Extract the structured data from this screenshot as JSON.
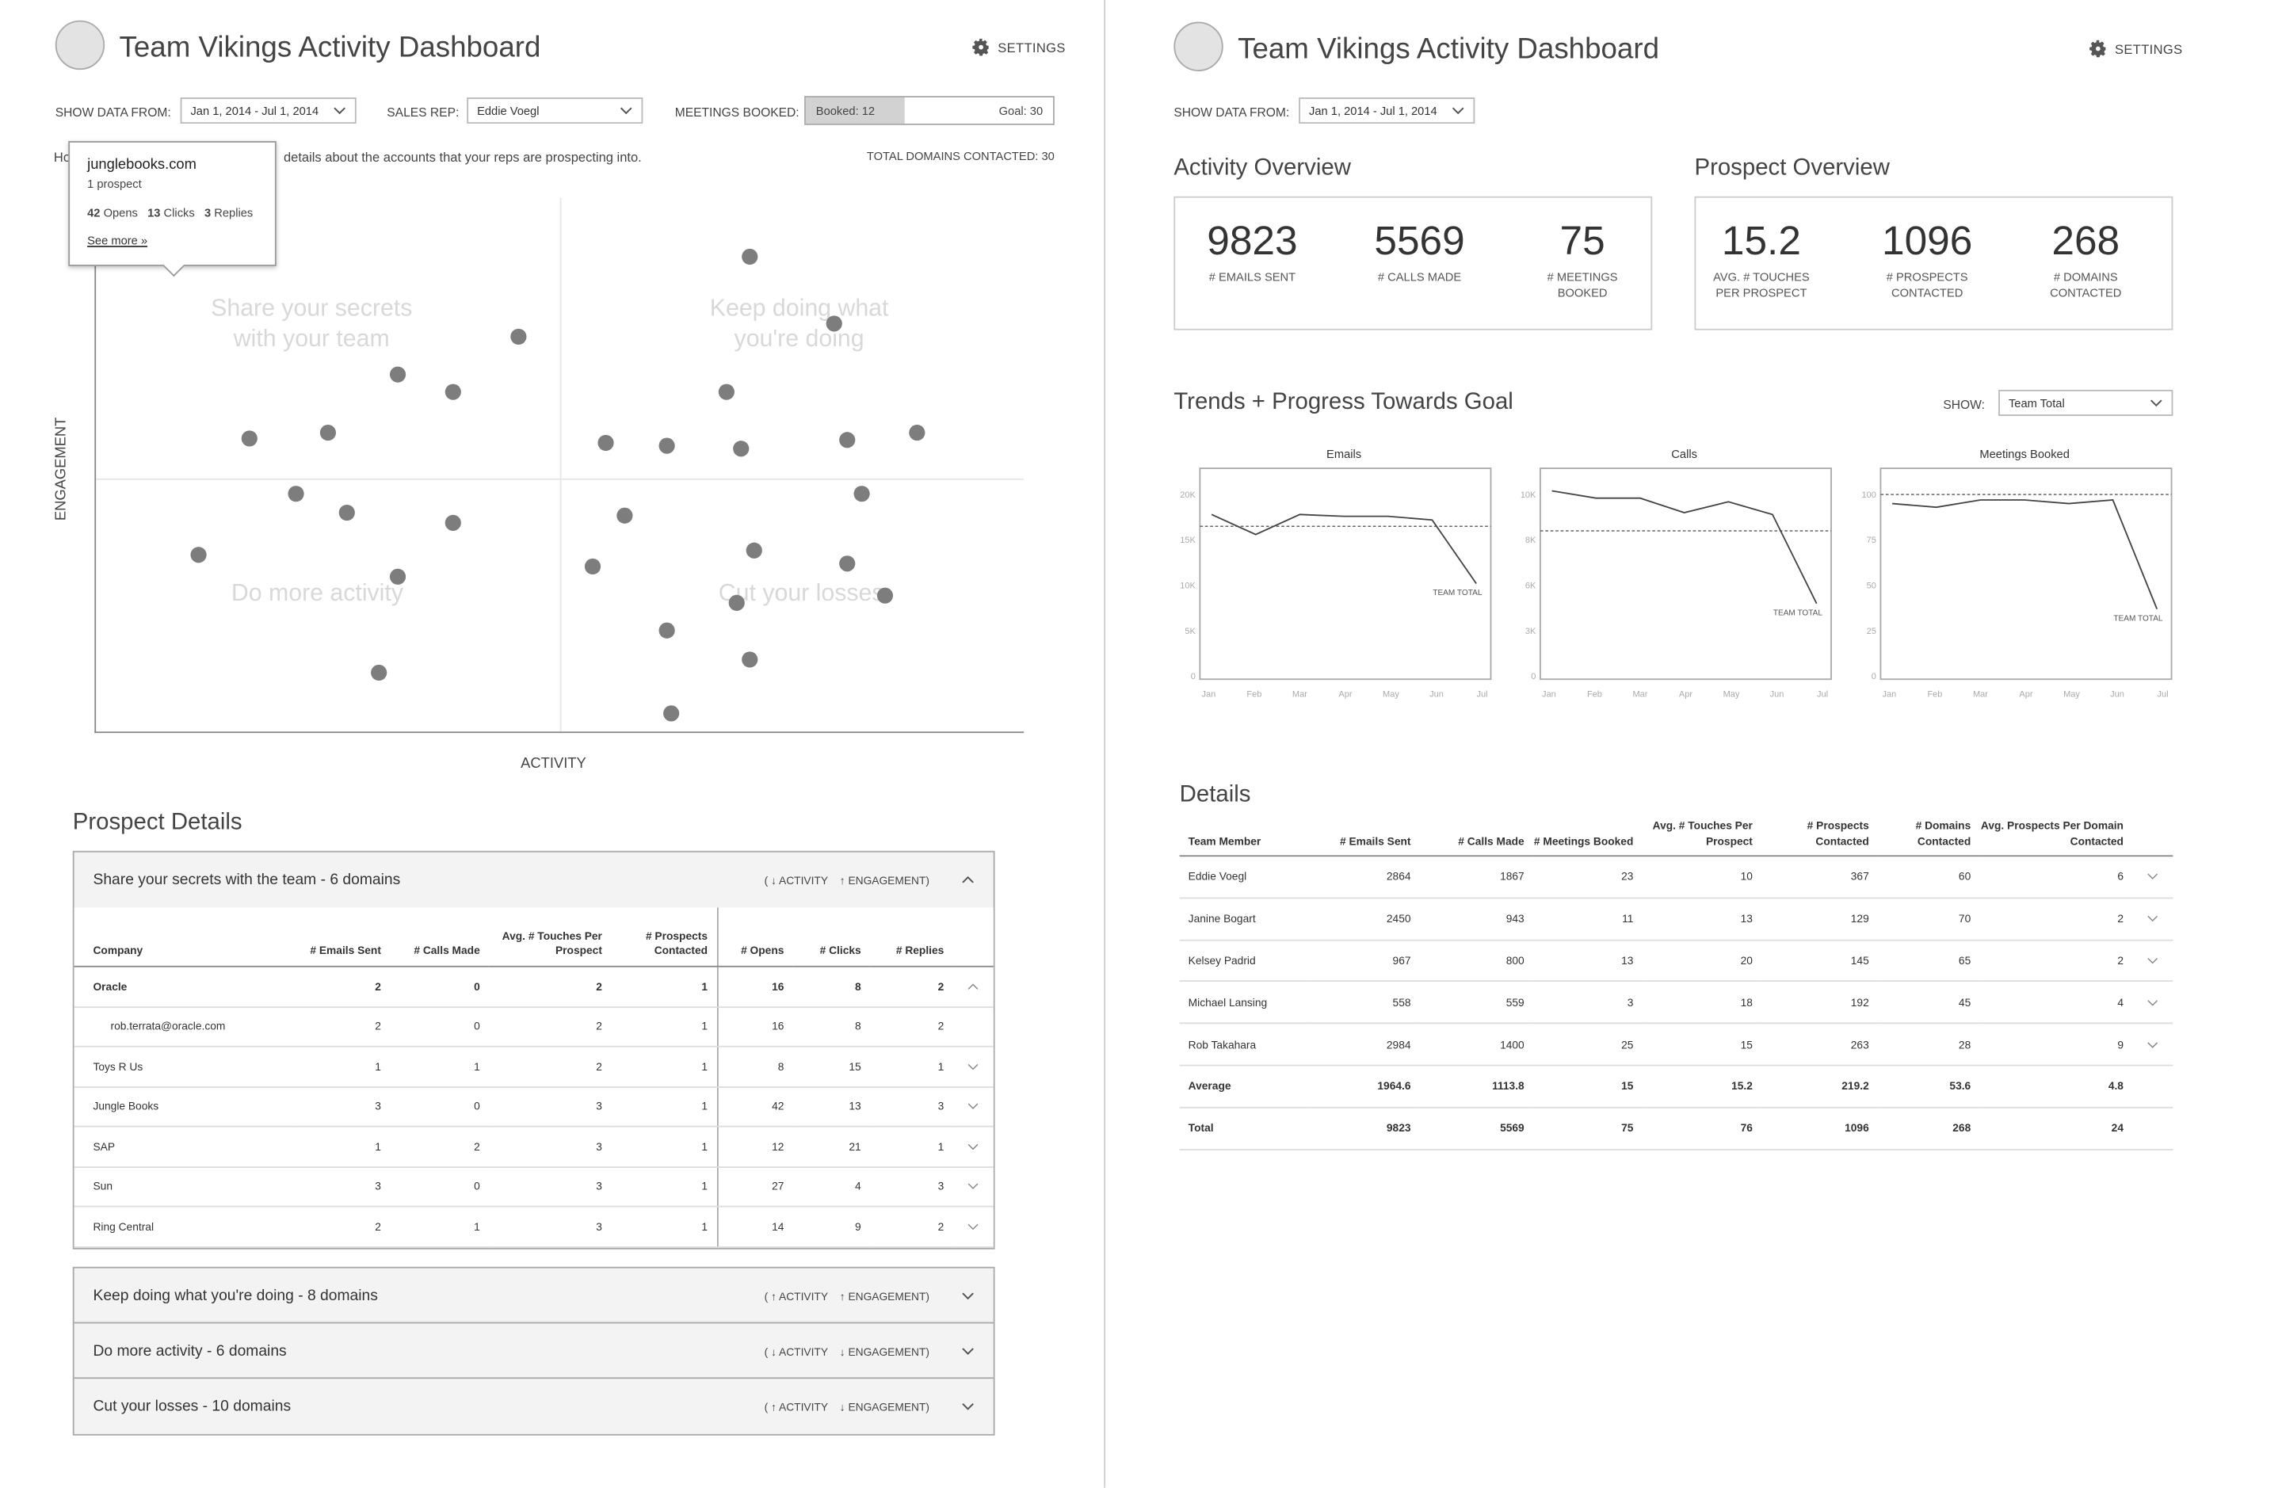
{
  "left": {
    "title": "Team Vikings Activity Dashboard",
    "settings_label": "SETTINGS",
    "filters": {
      "show_data_label": "SHOW DATA FROM:",
      "date_range": "Jan 1, 2014 - Jul 1, 2014",
      "sales_rep_label": "SALES REP:",
      "sales_rep": "Eddie Voegl",
      "meetings_label": "MEETINGS BOOKED:",
      "booked": "Booked: 12",
      "goal": "Goal: 30",
      "booked_fraction": 0.4
    },
    "intro_left": "Ho",
    "intro_right": "details about the accounts that your reps are prospecting into.",
    "total_domains": "TOTAL DOMAINS CONTACTED: 30",
    "tooltip": {
      "domain": "junglebooks.com",
      "prospects": "1 prospect",
      "opens_num": "42",
      "opens_lbl": "Opens",
      "clicks_num": "13",
      "clicks_lbl": "Clicks",
      "replies_num": "3",
      "replies_lbl": "Replies",
      "link": "See more »"
    },
    "scatter": {
      "y_label": "ENGAGEMENT",
      "x_label": "ACTIVITY",
      "quadrants": {
        "tl": [
          "Share your secrets",
          "with your team"
        ],
        "tr": [
          "Keep doing what",
          "you're doing"
        ],
        "bl": [
          "Do more activity"
        ],
        "br": [
          "Cut your losses"
        ]
      },
      "points": [
        {
          "x": 0.085,
          "y": 0.92,
          "selected": true
        },
        {
          "x": 0.455,
          "y": 0.74
        },
        {
          "x": 0.325,
          "y": 0.67
        },
        {
          "x": 0.385,
          "y": 0.635
        },
        {
          "x": 0.165,
          "y": 0.55
        },
        {
          "x": 0.25,
          "y": 0.56
        },
        {
          "x": 0.215,
          "y": 0.445
        },
        {
          "x": 0.27,
          "y": 0.41
        },
        {
          "x": 0.385,
          "y": 0.39
        },
        {
          "x": 0.11,
          "y": 0.33
        },
        {
          "x": 0.325,
          "y": 0.29
        },
        {
          "x": 0.305,
          "y": 0.11
        },
        {
          "x": 0.705,
          "y": 0.89
        },
        {
          "x": 0.795,
          "y": 0.765
        },
        {
          "x": 0.68,
          "y": 0.635
        },
        {
          "x": 0.55,
          "y": 0.54
        },
        {
          "x": 0.615,
          "y": 0.535
        },
        {
          "x": 0.695,
          "y": 0.53
        },
        {
          "x": 0.81,
          "y": 0.545
        },
        {
          "x": 0.885,
          "y": 0.56
        },
        {
          "x": 0.825,
          "y": 0.445
        },
        {
          "x": 0.57,
          "y": 0.405
        },
        {
          "x": 0.71,
          "y": 0.34
        },
        {
          "x": 0.535,
          "y": 0.31
        },
        {
          "x": 0.81,
          "y": 0.315
        },
        {
          "x": 0.85,
          "y": 0.255
        },
        {
          "x": 0.69,
          "y": 0.24
        },
        {
          "x": 0.615,
          "y": 0.19
        },
        {
          "x": 0.705,
          "y": 0.135
        },
        {
          "x": 0.62,
          "y": 0.035
        }
      ]
    },
    "prospect_details": {
      "title": "Prospect Details",
      "sort_activity": "ACTIVITY",
      "sort_engagement": "ENGAGEMENT)",
      "groups": [
        {
          "label": "Share your secrets with the team - 6 domains",
          "act_dir": "down",
          "eng_dir": "up"
        },
        {
          "label": "Keep doing what you're doing - 8 domains",
          "act_dir": "up",
          "eng_dir": "up"
        },
        {
          "label": "Do more activity - 6 domains",
          "act_dir": "down",
          "eng_dir": "down"
        },
        {
          "label": "Cut your losses - 10 domains",
          "act_dir": "up",
          "eng_dir": "down"
        }
      ],
      "columns": [
        "Company",
        "# Emails Sent",
        "# Calls Made",
        "Avg. # Touches Per Prospect",
        "# Prospects Contacted",
        "# Opens",
        "# Clicks",
        "# Replies"
      ],
      "rows": [
        {
          "company": "Oracle",
          "cells": [
            "2",
            "0",
            "2",
            "1",
            "16",
            "8",
            "2"
          ],
          "bold": true,
          "expanded": true
        },
        {
          "company": "rob.terrata@oracle.com",
          "cells": [
            "2",
            "0",
            "2",
            "1",
            "16",
            "8",
            "2"
          ],
          "sub": true
        },
        {
          "company": "Toys R Us",
          "cells": [
            "1",
            "1",
            "2",
            "1",
            "8",
            "15",
            "1"
          ]
        },
        {
          "company": "Jungle Books",
          "cells": [
            "3",
            "0",
            "3",
            "1",
            "42",
            "13",
            "3"
          ]
        },
        {
          "company": "SAP",
          "cells": [
            "1",
            "2",
            "3",
            "1",
            "12",
            "21",
            "1"
          ]
        },
        {
          "company": "Sun",
          "cells": [
            "3",
            "0",
            "3",
            "1",
            "27",
            "4",
            "3"
          ]
        },
        {
          "company": "Ring Central",
          "cells": [
            "2",
            "1",
            "3",
            "1",
            "14",
            "9",
            "2"
          ]
        }
      ]
    }
  },
  "right": {
    "title": "Team Vikings Activity Dashboard",
    "settings_label": "SETTINGS",
    "show_data_label": "SHOW DATA FROM:",
    "date_range": "Jan 1, 2014 - Jul 1, 2014",
    "activity_overview": {
      "title": "Activity Overview",
      "kpis": [
        {
          "value": "9823",
          "label": [
            "# EMAILS SENT"
          ]
        },
        {
          "value": "5569",
          "label": [
            "# CALLS MADE"
          ]
        },
        {
          "value": "75",
          "label": [
            "# MEETINGS",
            "BOOKED"
          ]
        }
      ]
    },
    "prospect_overview": {
      "title": "Prospect Overview",
      "kpis": [
        {
          "value": "15.2",
          "label": [
            "AVG. # TOUCHES",
            "PER PROSPECT"
          ]
        },
        {
          "value": "1096",
          "label": [
            "# PROSPECTS",
            "CONTACTED"
          ]
        },
        {
          "value": "268",
          "label": [
            "# DOMAINS",
            "CONTACTED"
          ]
        }
      ]
    },
    "trends": {
      "title": "Trends + Progress Towards Goal",
      "show_label": "SHOW:",
      "show_value": "Team Total",
      "end_label": "TEAM TOTAL"
    },
    "details": {
      "title": "Details",
      "columns": [
        "Team Member",
        "# Emails Sent",
        "# Calls Made",
        "# Meetings Booked",
        "Avg. # Touches Per Prospect",
        "# Prospects Contacted",
        "# Domains Contacted",
        "Avg. Prospects Per Domain Contacted"
      ],
      "rows": [
        {
          "cells": [
            "Eddie Voegl",
            "2864",
            "1867",
            "23",
            "10",
            "367",
            "60",
            "6"
          ],
          "chev": true
        },
        {
          "cells": [
            "Janine Bogart",
            "2450",
            "943",
            "11",
            "13",
            "129",
            "70",
            "2"
          ],
          "chev": true
        },
        {
          "cells": [
            "Kelsey Padrid",
            "967",
            "800",
            "13",
            "20",
            "145",
            "65",
            "2"
          ],
          "chev": true
        },
        {
          "cells": [
            "Michael Lansing",
            "558",
            "559",
            "3",
            "18",
            "192",
            "45",
            "4"
          ],
          "chev": true
        },
        {
          "cells": [
            "Rob Takahara",
            "2984",
            "1400",
            "25",
            "15",
            "263",
            "28",
            "9"
          ],
          "chev": true
        },
        {
          "cells": [
            "Average",
            "1964.6",
            "1113.8",
            "15",
            "15.2",
            "219.2",
            "53.6",
            "4.8"
          ],
          "bold": true
        },
        {
          "cells": [
            "Total",
            "9823",
            "5569",
            "75",
            "76",
            "1096",
            "268",
            "24"
          ],
          "bold": true
        }
      ]
    }
  },
  "chart_data": [
    {
      "type": "line",
      "title": "Emails",
      "x": [
        "Jan",
        "Feb",
        "Mar",
        "Apr",
        "May",
        "Jun",
        "Jul"
      ],
      "y_ticks": [
        "0",
        "5K",
        "10K",
        "15K",
        "20K"
      ],
      "ylim": [
        0,
        20000
      ],
      "goal": 16500,
      "series": [
        {
          "name": "TEAM TOTAL",
          "values": [
            17800,
            15600,
            17800,
            17600,
            17600,
            17200,
            10200
          ]
        }
      ]
    },
    {
      "type": "line",
      "title": "Calls",
      "x": [
        "Jan",
        "Feb",
        "Mar",
        "Apr",
        "May",
        "Jun",
        "Jul"
      ],
      "y_ticks": [
        "0",
        "3K",
        "6K",
        "8K",
        "10K"
      ],
      "ylim": [
        0,
        10000
      ],
      "goal": 8000,
      "series": [
        {
          "name": "TEAM TOTAL",
          "values": [
            10200,
            9800,
            9800,
            9000,
            9600,
            8900,
            4000
          ]
        }
      ]
    },
    {
      "type": "line",
      "title": "Meetings Booked",
      "x": [
        "Jan",
        "Feb",
        "Mar",
        "Apr",
        "May",
        "Jun",
        "Jul"
      ],
      "y_ticks": [
        "0",
        "25",
        "50",
        "75",
        "100"
      ],
      "ylim": [
        0,
        100
      ],
      "goal": 100,
      "series": [
        {
          "name": "TEAM TOTAL",
          "values": [
            95,
            93,
            97,
            97,
            95,
            97,
            37
          ]
        }
      ]
    }
  ]
}
